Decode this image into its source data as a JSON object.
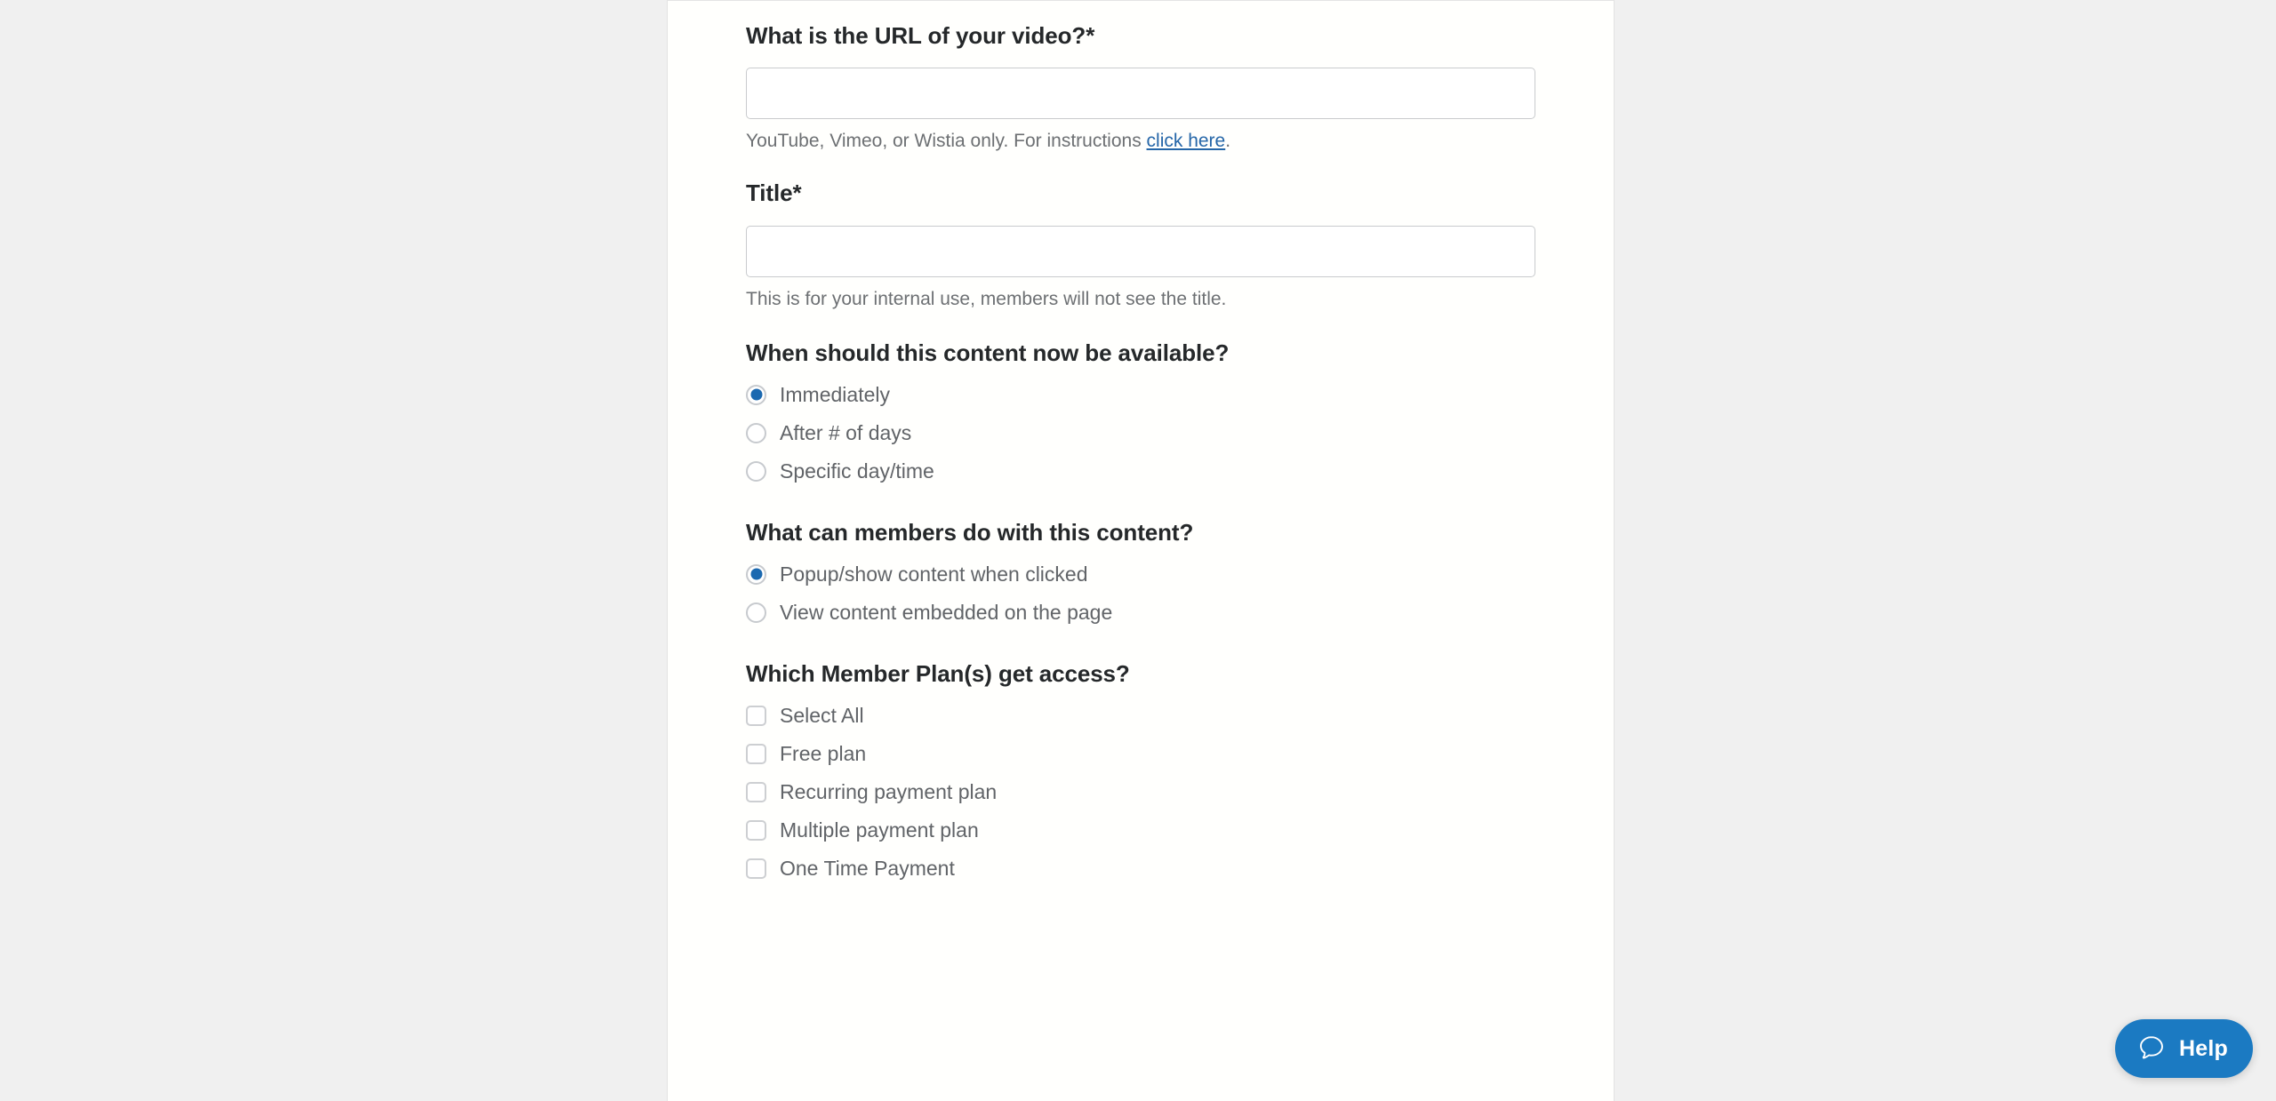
{
  "theme": {
    "page_background": "#f0f0f0",
    "card_background": "#fffffd",
    "accent_blue": "#1b69b0",
    "link_blue": "#2566a8",
    "help_widget_blue": "#1b7ac2",
    "heading_color": "#25282a",
    "label_color": "#616468",
    "help_text_color": "#6d7073"
  },
  "form": {
    "video_url": {
      "label": "What is the URL of your video?*",
      "value": "",
      "placeholder": "",
      "help_prefix": "YouTube, Vimeo, or Wistia only. For instructions ",
      "help_link": "click here",
      "help_suffix": "."
    },
    "title": {
      "label": "Title*",
      "value": "",
      "placeholder": "",
      "help": "This is for your internal use, members will not see the title."
    },
    "availability": {
      "title": "When should this content now be available?",
      "options": [
        {
          "label": "Immediately",
          "selected": true
        },
        {
          "label": "After # of days",
          "selected": false
        },
        {
          "label": "Specific day/time",
          "selected": false
        }
      ]
    },
    "member_actions": {
      "title": "What can members do with this content?",
      "options": [
        {
          "label": "Popup/show content when clicked",
          "selected": true
        },
        {
          "label": "View content embedded on the page",
          "selected": false
        }
      ]
    },
    "member_plans": {
      "title": "Which Member Plan(s) get access?",
      "options": [
        {
          "label": "Select All",
          "checked": false
        },
        {
          "label": "Free plan",
          "checked": false
        },
        {
          "label": "Recurring payment plan",
          "checked": false
        },
        {
          "label": "Multiple payment plan",
          "checked": false
        },
        {
          "label": "One Time Payment",
          "checked": false
        }
      ]
    }
  },
  "help_widget": {
    "label": "Help",
    "icon": "chat-bubble-icon"
  }
}
